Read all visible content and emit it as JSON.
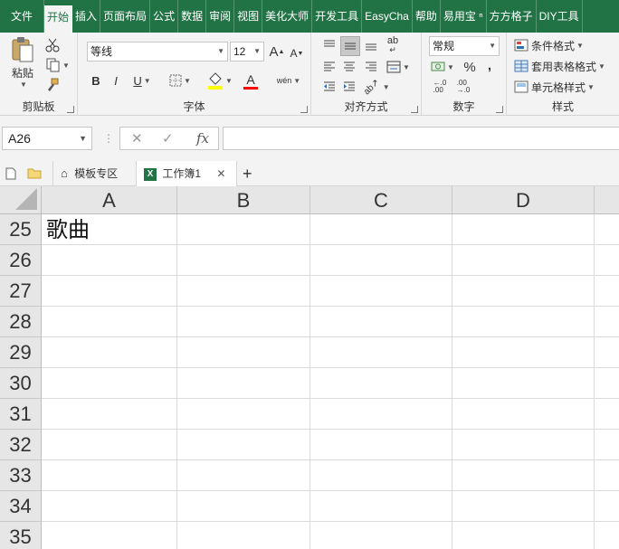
{
  "ribbon_tabs": [
    "文件",
    "开始",
    "插入",
    "页面布局",
    "公式",
    "数据",
    "审阅",
    "视图",
    "美化大师",
    "开发工具",
    "EasyCha",
    "帮助",
    "易用宝 ⁿ",
    "方方格子",
    "DIY工具"
  ],
  "clipboard": {
    "paste_label": "粘贴",
    "group_label": "剪贴板"
  },
  "font": {
    "name": "等线",
    "size": "12",
    "group_label": "字体",
    "grow_label": "A",
    "shrink_label": "A",
    "bold": "B",
    "italic": "I",
    "underline": "U",
    "font_color_letter": "A",
    "phonetic": "wén"
  },
  "alignment": {
    "group_label": "对齐方式",
    "wrap_label": "ab"
  },
  "number": {
    "format": "常规",
    "group_label": "数字",
    "percent": "%",
    "comma": ","
  },
  "styles": {
    "conditional": "条件格式",
    "table": "套用表格格式",
    "cell": "单元格样式",
    "group_label": "样式"
  },
  "colors": {
    "accent": "#217346",
    "highlight": "#ffff00",
    "font_red": "#ff0000"
  },
  "formula_bar": {
    "name_box": "A26",
    "formula": ""
  },
  "doc_tabs": {
    "template": "模板专区",
    "workbook": "工作簿1",
    "close": "✕",
    "add": "+"
  },
  "columns": [
    "A",
    "B",
    "C",
    "D"
  ],
  "rows": [
    "25",
    "26",
    "27",
    "28",
    "29",
    "30",
    "31",
    "32",
    "33",
    "34",
    "35"
  ],
  "cells": {
    "A25": "歌曲"
  }
}
